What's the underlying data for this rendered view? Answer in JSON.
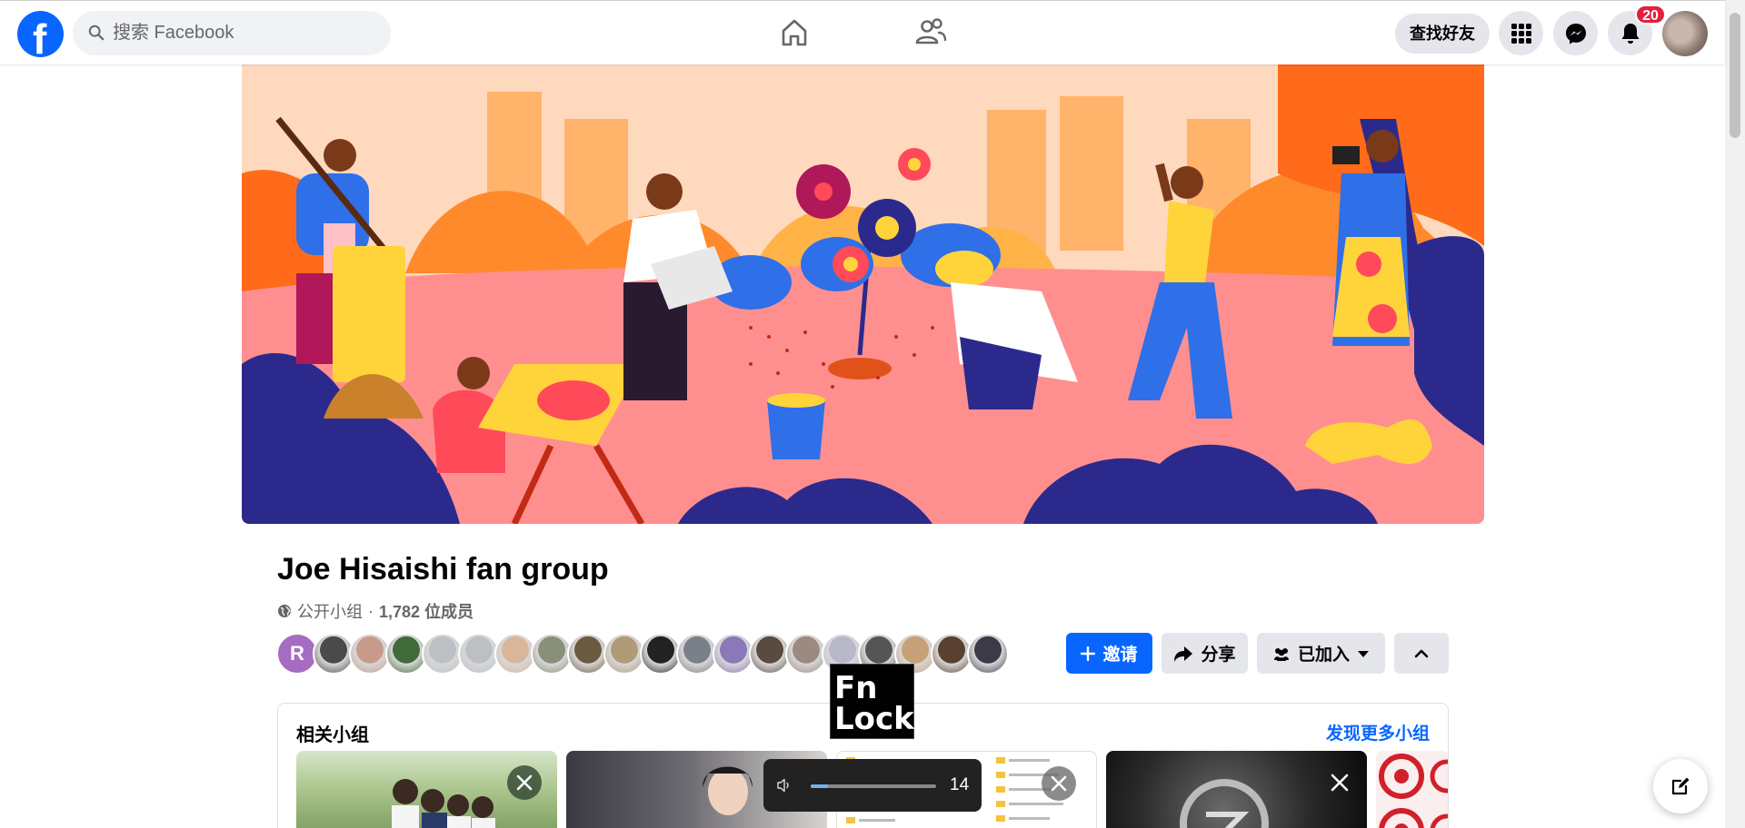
{
  "topbar": {
    "search_placeholder": "搜索 Facebook",
    "find_friends_label": "查找好友",
    "notification_count": "20"
  },
  "group": {
    "name": "Joe Hisaishi fan group",
    "privacy": "公开小组",
    "separator": "·",
    "member_count": "1,782 位成员",
    "first_member_initial": "R",
    "member_avatar_colors": [
      "#4a4a4a",
      "#c89a8a",
      "#3f6b3a",
      "#bcc0c4",
      "#bcc0c4",
      "#d9b69a",
      "#8a8f7a",
      "#6b5a3f",
      "#b09a78",
      "#222222",
      "#7a8088",
      "#8a78b8",
      "#5a4a40",
      "#9a8a80",
      "#b8b8c8",
      "#555555",
      "#c8a078",
      "#5a4030",
      "#3a3a48"
    ]
  },
  "actions": {
    "invite_label": "邀请",
    "share_label": "分享",
    "joined_label": "已加入"
  },
  "related": {
    "title": "相关小组",
    "more_link": "发现更多小组"
  },
  "overlay": {
    "fn_line1": "Fn",
    "fn_line2": "Lock",
    "volume_value": "14",
    "volume_fraction": 0.14
  },
  "colors": {
    "brand_blue": "#0866ff",
    "button_gray": "#e4e6eb",
    "badge_red": "#e41e3f"
  }
}
